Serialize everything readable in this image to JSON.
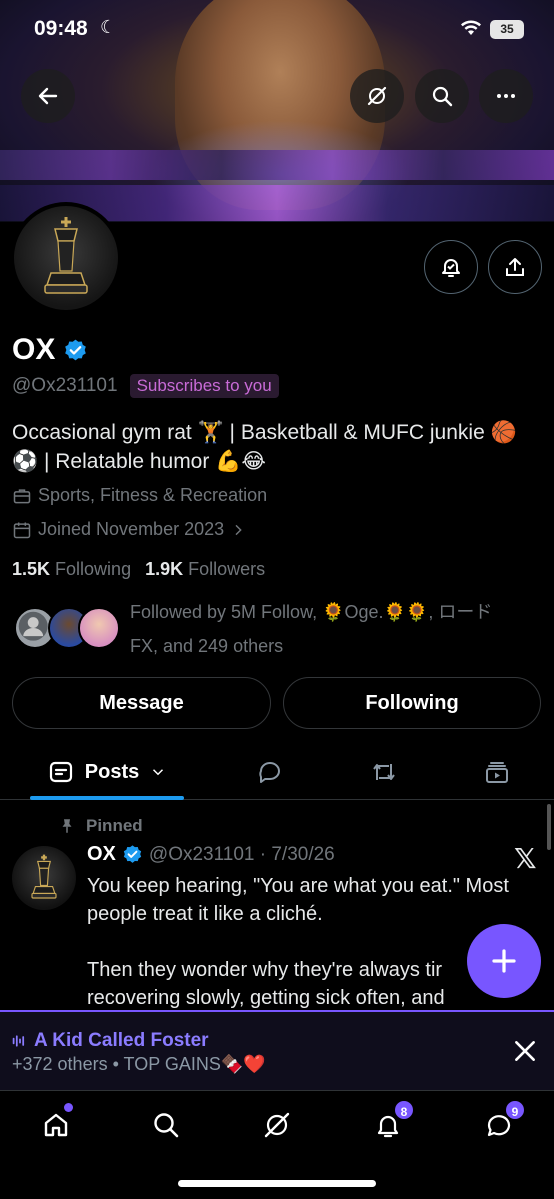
{
  "status_bar": {
    "time": "09:48",
    "battery": "35"
  },
  "header": {
    "back_icon": "arrow-left-icon",
    "grok_icon": "grok-slash-icon",
    "search_icon": "search-icon",
    "more_icon": "more-horizontal-icon"
  },
  "profile": {
    "name": "OX",
    "handle": "@Ox231101",
    "subscribes_badge": "Subscribes to you",
    "bio_line1": "Occasional gym rat 🏋️ | Basketball & MUFC junkie 🏀",
    "bio_line2": "⚽ | Relatable humor 💪😂",
    "category": "Sports, Fitness & Recreation",
    "joined": "Joined November 2023",
    "following_count": "1.5K",
    "following_label": "Following",
    "followers_count": "1.9K",
    "followers_label": "Followers",
    "followed_by_line1": "Followed by 5M Follow, 🌻Oge.🌻🌻, ロード",
    "followed_by_line2": "FX, and 249 others"
  },
  "actions": {
    "message": "Message",
    "following": "Following"
  },
  "tabs": {
    "posts": "Posts"
  },
  "pinned_post": {
    "pinned_label": "Pinned",
    "author": "OX",
    "handle_date": "@Ox231101 · 7/30/26",
    "text": "You keep hearing, \"You are what you eat.\" Most people treat it like a cliché.\n\nThen they wonder why they're always tir\nrecovering slowly, getting sick often, and"
  },
  "space_bar": {
    "title": "A Kid Called Foster",
    "subtitle": "+372 others • TOP GAINS🍫❤️"
  },
  "bottom_nav": {
    "notifications_badge": "8",
    "messages_badge": "9"
  },
  "colors": {
    "accent": "#7856ff",
    "verified": "#1d9bf0",
    "muted": "#71767b",
    "badge_purple": "#c86bd6"
  }
}
